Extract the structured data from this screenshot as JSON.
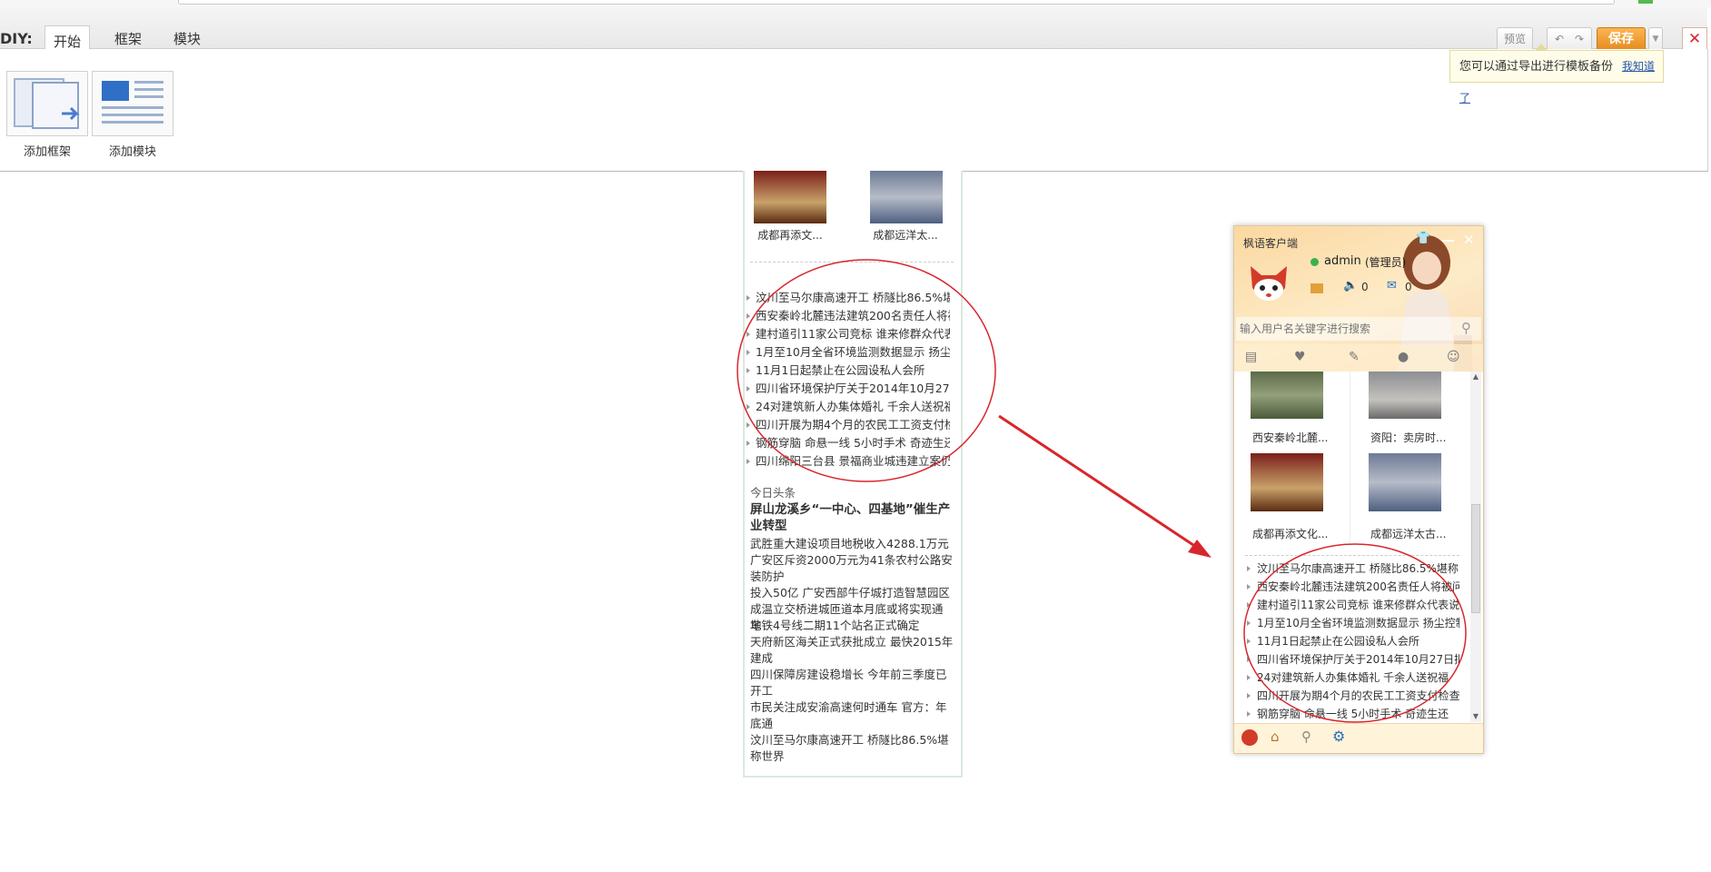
{
  "diy_bar": {
    "label": "DIY:",
    "tabs": [
      "开始",
      "框架",
      "模块"
    ],
    "preview_label": "预览",
    "save_label": "保存",
    "tip_text": "您可以通过导出进行模板备份",
    "tip_link": "我知道了"
  },
  "add_panel": {
    "add_frame_label": "添加框架",
    "add_module_label": "添加模块"
  },
  "main_column": {
    "thumb_captions": [
      "成都再添文...",
      "成都远洋太..."
    ],
    "news_items": [
      "汶川至马尔康高速开工 桥隧比86.5%堪",
      "西安秦岭北麓违法建筑200名责任人将被",
      "建村道引11家公司竞标 谁来修群众代表",
      "1月至10月全省环境监测数据显示 扬尘",
      "11月1日起禁止在公园设私人会所",
      "四川省环境保护厅关于2014年10月27日",
      "24对建筑新人办集体婚礼 千余人送祝福",
      "四川开展为期4个月的农民工工资支付检",
      "钢筋穿脑 命悬一线 5小时手术 奇迹生还",
      "四川绵阳三台县 景福商业城违建立案仍"
    ],
    "headline_section_title": "今日头条",
    "headline_title": "屏山龙溪乡“一中心、四基地”催生产业转型",
    "headline_items": [
      "武胜重大建设项目地税收入4288.1万元",
      "广安区斥资2000万元为41条农村公路安装防护",
      "投入50亿 广安西部牛仔城打造智慧园区",
      "成温立交桥进城匝道本月底或将实现通车",
      "地铁4号线二期11个站名正式确定",
      "天府新区海关正式获批成立 最快2015年建成",
      "四川保障房建设稳增长 今年前三季度已开工",
      "市民关注成安渝高速何时通车 官方：年底通",
      "汶川至马尔康高速开工 桥隧比86.5%堪称世界"
    ]
  },
  "client": {
    "title": "枫语客户端",
    "username": "admin",
    "user_status": "(管理员)",
    "sound_count": "0",
    "mail_count": "0",
    "search_placeholder": "输入用户名关键字进行搜索",
    "thumb_captions": [
      "西安秦岭北麓...",
      "资阳：卖房时...",
      "成都再添文化...",
      "成都远洋太古..."
    ],
    "news_items": [
      "汶川至马尔康高速开工 桥隧比86.5%堪称",
      "西安秦岭北麓违法建筑200名责任人将被问",
      "建村道引11家公司竞标 谁来修群众代表说",
      "1月至10月全省环境监测数据显示 扬尘控制",
      "11月1日起禁止在公园设私人会所",
      "四川省环境保护厅关于2014年10月27日拟",
      "24对建筑新人办集体婚礼 千余人送祝福",
      "四川开展为期4个月的农民工工资支付检查",
      "钢筋穿脑 命悬一线 5小时手术 奇迹生还"
    ]
  },
  "colors": {
    "save_orange": "#e6891b",
    "annotation_red": "#d8262c",
    "tip_background": "#fffde9",
    "client_header": "#fcd8a0"
  },
  "icons": [
    "undo-icon",
    "redo-icon",
    "close-icon",
    "online-status-icon",
    "sound-icon",
    "mail-icon",
    "search-icon",
    "avatar-icon",
    "home-icon",
    "settings-icon"
  ]
}
